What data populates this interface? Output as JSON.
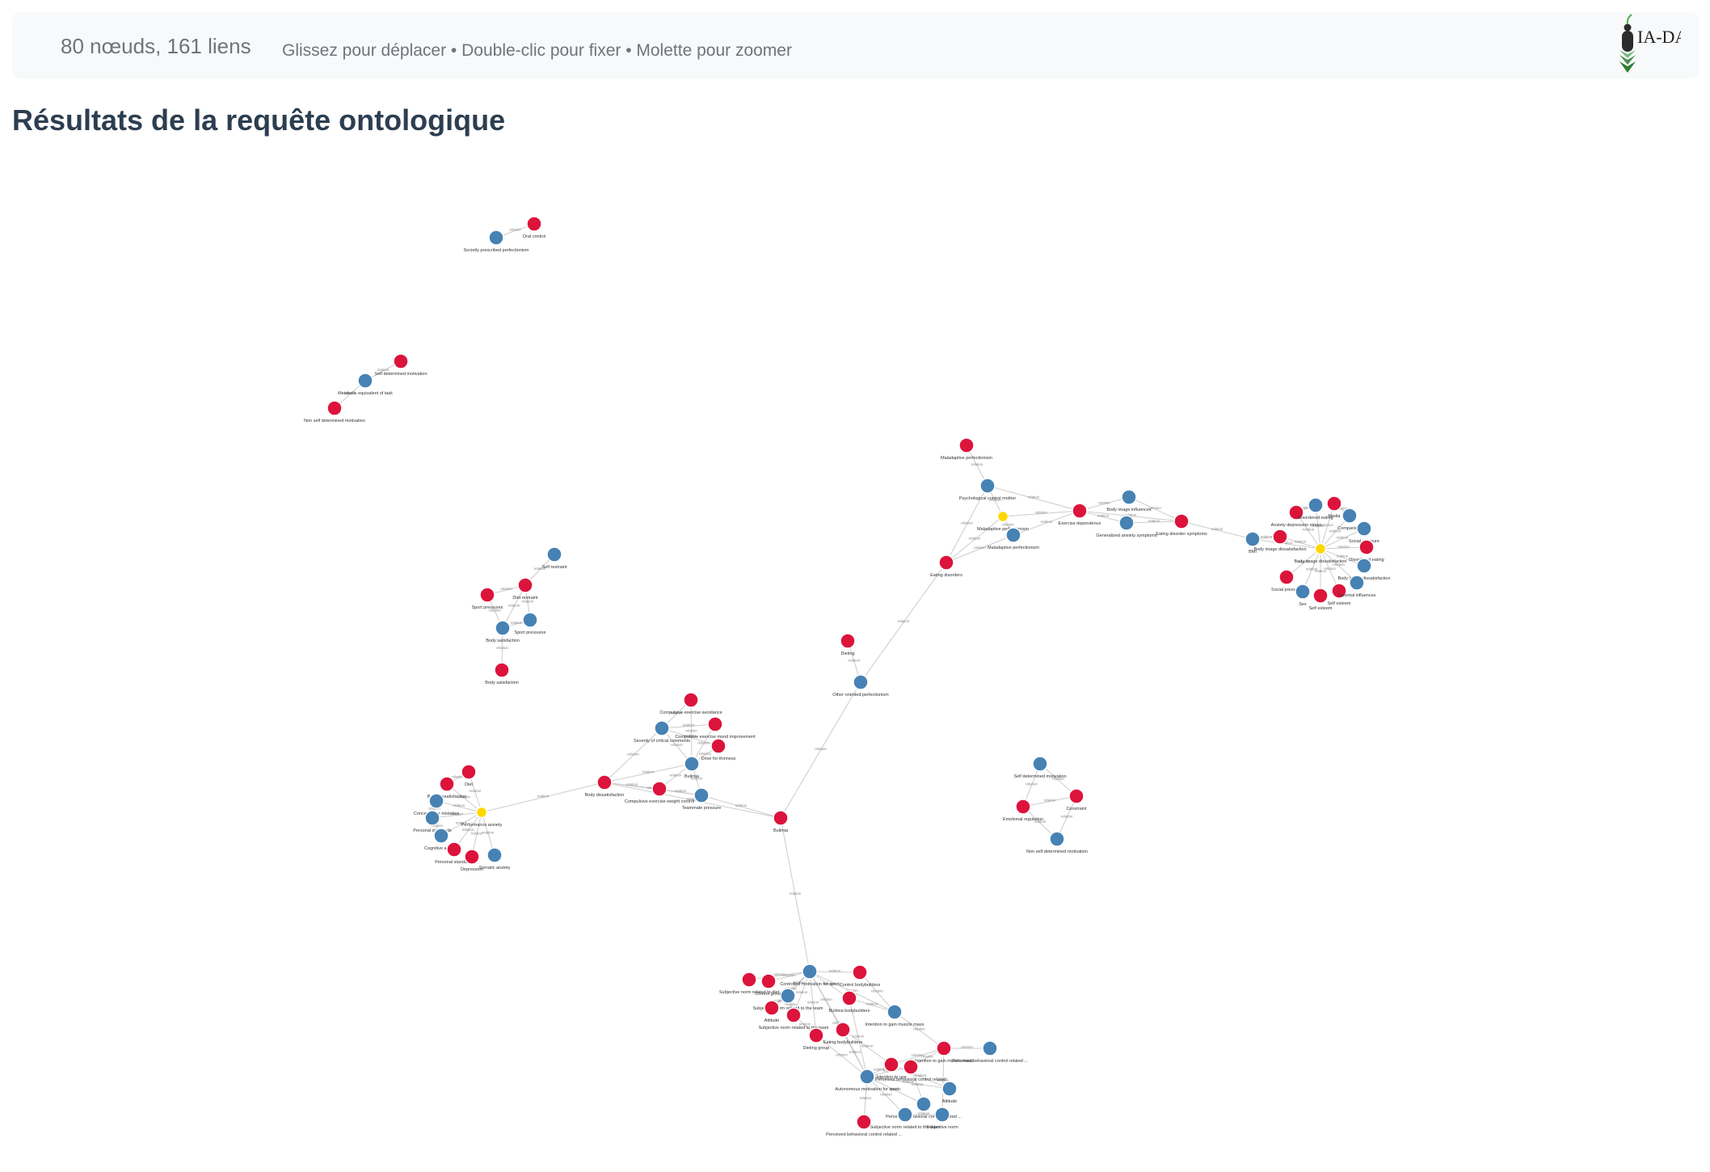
{
  "header": {
    "counts": "80 nœuds, 161 liens",
    "hint": "Glissez pour déplacer • Double-clic pour fixer • Molette pour zoomer",
    "logo_text": "IA-DAS"
  },
  "title": "Résultats de la requête ontologique",
  "colors": {
    "blue": "#4682b4",
    "red": "#dc143c",
    "yellow": "#ffd700",
    "edge": "#cccccc",
    "label": "#333333",
    "title": "#2c3e50",
    "muted": "#6c757d"
  },
  "edge_label": "relation",
  "legend_colors": {
    "b": "blue",
    "r": "red",
    "y": "yellow"
  },
  "graph": {
    "nodes": [
      [
        "n1",
        "b",
        "Societly prescribed perfectionism"
      ],
      [
        "n2",
        "r",
        "Oral control"
      ],
      [
        "n3",
        "r",
        "Self determined motivation"
      ],
      [
        "n4",
        "b",
        "Metabolic equivalent of task"
      ],
      [
        "n5",
        "r",
        "Non self determined motivation"
      ],
      [
        "n6",
        "b",
        "Self restraint"
      ],
      [
        "n7",
        "r",
        "Diet restraint"
      ],
      [
        "n8",
        "r",
        "Sport pressures"
      ],
      [
        "n9",
        "b",
        "Body satisfaction"
      ],
      [
        "n10",
        "b",
        "Sport pressures"
      ],
      [
        "n11",
        "r",
        "Body satisfaction"
      ],
      [
        "n12",
        "r",
        "Maladaptive perfectionism"
      ],
      [
        "n13",
        "b",
        "Psychological control mother"
      ],
      [
        "n14",
        "y",
        "Maladaptive perfectionism"
      ],
      [
        "n15",
        "b",
        "Maladaptive perfectionism"
      ],
      [
        "n16",
        "r",
        "Eating disorders"
      ],
      [
        "n17",
        "r",
        "Exercise dependence"
      ],
      [
        "n18",
        "b",
        "Body image influences"
      ],
      [
        "n19",
        "b",
        "Generalized anxiety symptoms"
      ],
      [
        "n20",
        "r",
        "Eating disorder symptoms"
      ],
      [
        "n21",
        "b",
        "BMI"
      ],
      [
        "n22",
        "r",
        "Body image dissatisfaction"
      ],
      [
        "n23",
        "y",
        "Body image dissatisfaction"
      ],
      [
        "n24",
        "r",
        "Anxiety depression stress"
      ],
      [
        "n25",
        "b",
        "Disordered eating"
      ],
      [
        "n26",
        "r",
        "Media"
      ],
      [
        "n27",
        "b",
        "Comparison"
      ],
      [
        "n28",
        "b",
        "Social pressure"
      ],
      [
        "n29",
        "r",
        "Disordered eating"
      ],
      [
        "n30",
        "b",
        "Body image dissatisfaction"
      ],
      [
        "n31",
        "r",
        "Social pressure"
      ],
      [
        "n32",
        "b",
        "Sex"
      ],
      [
        "n33",
        "r",
        "Self esteem"
      ],
      [
        "n34",
        "r",
        "Self esteem"
      ],
      [
        "n35",
        "b",
        "Parental influences"
      ],
      [
        "n36",
        "r",
        "Dieting"
      ],
      [
        "n37",
        "b",
        "Other oriented perfectionism"
      ],
      [
        "n38",
        "r",
        "Compulsive exercise avoidance"
      ],
      [
        "n39",
        "b",
        "Severity of critical comments"
      ],
      [
        "n40",
        "r",
        "Compulsive exercise mood improvement"
      ],
      [
        "n41",
        "r",
        "Drive for thinness"
      ],
      [
        "n42",
        "b",
        "Bulimia"
      ],
      [
        "n43",
        "r",
        "Body dissatisfaction"
      ],
      [
        "n44",
        "r",
        "Compulsive exercise weight control"
      ],
      [
        "n45",
        "b",
        "Teammate pressure"
      ],
      [
        "n46",
        "r",
        "Bulimia"
      ],
      [
        "n47",
        "r",
        "Diet"
      ],
      [
        "n48",
        "r",
        "Body dissatisfaction"
      ],
      [
        "n49",
        "b",
        "Concern over mistakes"
      ],
      [
        "n50",
        "y",
        "Performance anxiety"
      ],
      [
        "n51",
        "b",
        "Personal standards"
      ],
      [
        "n52",
        "b",
        "Cognitive anxiety"
      ],
      [
        "n53",
        "r",
        "Personal standards"
      ],
      [
        "n54",
        "r",
        "Depression"
      ],
      [
        "n55",
        "b",
        "Somatic anxiety"
      ],
      [
        "n56",
        "b",
        "Self determined motivation"
      ],
      [
        "n57",
        "r",
        "Emotional regulation"
      ],
      [
        "n58",
        "r",
        "Constraint"
      ],
      [
        "n59",
        "b",
        "Non self determined motivation"
      ],
      [
        "n60",
        "b",
        "Controlled motivation for sport"
      ],
      [
        "n61",
        "r",
        "Subjective norm related to diet"
      ],
      [
        "n62",
        "r",
        "Control group"
      ],
      [
        "n63",
        "r",
        "Control bodybuilders"
      ],
      [
        "n64",
        "b",
        "Subjective norm related to the team"
      ],
      [
        "n65",
        "r",
        "Attitude"
      ],
      [
        "n66",
        "r",
        "Bulimia bodybuilders"
      ],
      [
        "n67",
        "r",
        "Subjective norm related to the team"
      ],
      [
        "n68",
        "b",
        "Intention to gain muscle mass"
      ],
      [
        "n69",
        "r",
        "Dieting group"
      ],
      [
        "n70",
        "r",
        "Eating bodybuilders"
      ],
      [
        "n71",
        "r",
        "Intention to gain muscle mass"
      ],
      [
        "n72",
        "b",
        "Perceived behavioral control related ..."
      ],
      [
        "n73",
        "r",
        "Intention to use"
      ],
      [
        "n74",
        "r",
        "Perceived behavioral control related"
      ],
      [
        "n75",
        "b",
        "Autonomous motivation for sport"
      ],
      [
        "n76",
        "b",
        "Attitude"
      ],
      [
        "n77",
        "b",
        "Perceived behavioral control related ..."
      ],
      [
        "n78",
        "b",
        "Subjective norm related to the team"
      ],
      [
        "n79",
        "r",
        "Perceived behavioral control related ..."
      ],
      [
        "n80",
        "b",
        "Subjective norm"
      ]
    ],
    "edges": [
      [
        "n1",
        "n2"
      ],
      [
        "n4",
        "n3"
      ],
      [
        "n4",
        "n5"
      ],
      [
        "n6",
        "n7"
      ],
      [
        "n7",
        "n8"
      ],
      [
        "n7",
        "n9"
      ],
      [
        "n7",
        "n10"
      ],
      [
        "n8",
        "n9"
      ],
      [
        "n9",
        "n10"
      ],
      [
        "n9",
        "n11"
      ],
      [
        "n12",
        "n13"
      ],
      [
        "n13",
        "n14"
      ],
      [
        "n13",
        "n17"
      ],
      [
        "n14",
        "n15"
      ],
      [
        "n14",
        "n16"
      ],
      [
        "n14",
        "n17"
      ],
      [
        "n13",
        "n16"
      ],
      [
        "n15",
        "n16"
      ],
      [
        "n15",
        "n17"
      ],
      [
        "n17",
        "n18"
      ],
      [
        "n17",
        "n19"
      ],
      [
        "n17",
        "n20"
      ],
      [
        "n18",
        "n20"
      ],
      [
        "n19",
        "n20"
      ],
      [
        "n20",
        "n21"
      ],
      [
        "n21",
        "n22"
      ],
      [
        "n21",
        "n23"
      ],
      [
        "n23",
        "n22"
      ],
      [
        "n23",
        "n24"
      ],
      [
        "n23",
        "n25"
      ],
      [
        "n23",
        "n26"
      ],
      [
        "n23",
        "n27"
      ],
      [
        "n23",
        "n28"
      ],
      [
        "n23",
        "n29"
      ],
      [
        "n23",
        "n30"
      ],
      [
        "n23",
        "n31"
      ],
      [
        "n23",
        "n32"
      ],
      [
        "n23",
        "n33"
      ],
      [
        "n23",
        "n34"
      ],
      [
        "n23",
        "n35"
      ],
      [
        "n24",
        "n25"
      ],
      [
        "n26",
        "n27"
      ],
      [
        "n16",
        "n37"
      ],
      [
        "n36",
        "n37"
      ],
      [
        "n37",
        "n46"
      ],
      [
        "n38",
        "n39"
      ],
      [
        "n38",
        "n42"
      ],
      [
        "n39",
        "n40"
      ],
      [
        "n39",
        "n41"
      ],
      [
        "n39",
        "n42"
      ],
      [
        "n39",
        "n43"
      ],
      [
        "n40",
        "n42"
      ],
      [
        "n41",
        "n42"
      ],
      [
        "n42",
        "n43"
      ],
      [
        "n42",
        "n44"
      ],
      [
        "n42",
        "n45"
      ],
      [
        "n43",
        "n44"
      ],
      [
        "n43",
        "n45"
      ],
      [
        "n43",
        "n46"
      ],
      [
        "n45",
        "n46"
      ],
      [
        "n44",
        "n45"
      ],
      [
        "n43",
        "n50"
      ],
      [
        "n50",
        "n47"
      ],
      [
        "n50",
        "n48"
      ],
      [
        "n50",
        "n49"
      ],
      [
        "n50",
        "n51"
      ],
      [
        "n50",
        "n52"
      ],
      [
        "n50",
        "n53"
      ],
      [
        "n50",
        "n54"
      ],
      [
        "n50",
        "n55"
      ],
      [
        "n47",
        "n48"
      ],
      [
        "n49",
        "n51"
      ],
      [
        "n51",
        "n52"
      ],
      [
        "n56",
        "n57"
      ],
      [
        "n56",
        "n58"
      ],
      [
        "n57",
        "n59"
      ],
      [
        "n58",
        "n59"
      ],
      [
        "n57",
        "n58"
      ],
      [
        "n46",
        "n60"
      ],
      [
        "n60",
        "n61"
      ],
      [
        "n60",
        "n62"
      ],
      [
        "n60",
        "n63"
      ],
      [
        "n60",
        "n64"
      ],
      [
        "n60",
        "n65"
      ],
      [
        "n60",
        "n66"
      ],
      [
        "n60",
        "n67"
      ],
      [
        "n60",
        "n68"
      ],
      [
        "n60",
        "n69"
      ],
      [
        "n60",
        "n70"
      ],
      [
        "n60",
        "n75"
      ],
      [
        "n64",
        "n65"
      ],
      [
        "n64",
        "n67"
      ],
      [
        "n66",
        "n68"
      ],
      [
        "n68",
        "n71"
      ],
      [
        "n71",
        "n72"
      ],
      [
        "n71",
        "n73"
      ],
      [
        "n71",
        "n74"
      ],
      [
        "n73",
        "n75"
      ],
      [
        "n74",
        "n75"
      ],
      [
        "n75",
        "n76"
      ],
      [
        "n75",
        "n77"
      ],
      [
        "n75",
        "n78"
      ],
      [
        "n75",
        "n79"
      ],
      [
        "n73",
        "n76"
      ],
      [
        "n74",
        "n77"
      ],
      [
        "n70",
        "n75"
      ],
      [
        "n69",
        "n75"
      ],
      [
        "n66",
        "n75"
      ],
      [
        "n63",
        "n68"
      ],
      [
        "n67",
        "n69"
      ],
      [
        "n78",
        "n80"
      ],
      [
        "n71",
        "n80"
      ],
      [
        "n70",
        "n73"
      ]
    ]
  }
}
